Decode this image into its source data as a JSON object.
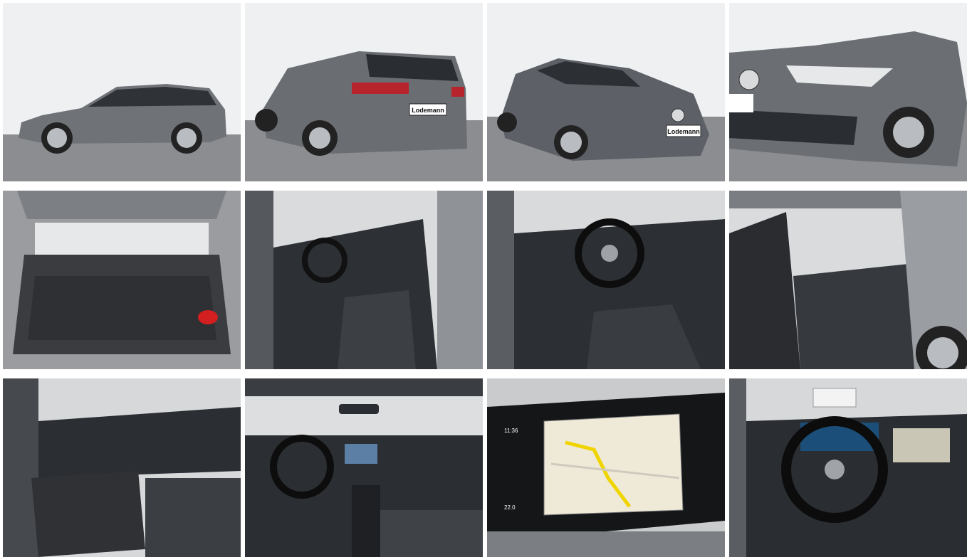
{
  "gallery": {
    "dealer_plate": "Lodemann",
    "tiles": [
      {
        "subject": "side-exterior-view"
      },
      {
        "subject": "rear-exterior-view"
      },
      {
        "subject": "front-three-quarter-view"
      },
      {
        "subject": "front-headlight-detail"
      },
      {
        "subject": "open-trunk-view"
      },
      {
        "subject": "driver-door-interior-view"
      },
      {
        "subject": "steering-wheel-dashboard-view"
      },
      {
        "subject": "rear-seats-view"
      },
      {
        "subject": "passenger-side-interior-view"
      },
      {
        "subject": "full-dashboard-view"
      },
      {
        "subject": "navigation-screen-view"
      },
      {
        "subject": "instrument-cluster-view"
      }
    ]
  },
  "navigation_screen": {
    "clock": "11:36",
    "temperature": "22.0"
  },
  "colors": {
    "car_body": "#6d7075",
    "sky": "#eceef0",
    "asphalt": "#8a8c8f",
    "interior_dark": "#2a2c30"
  }
}
